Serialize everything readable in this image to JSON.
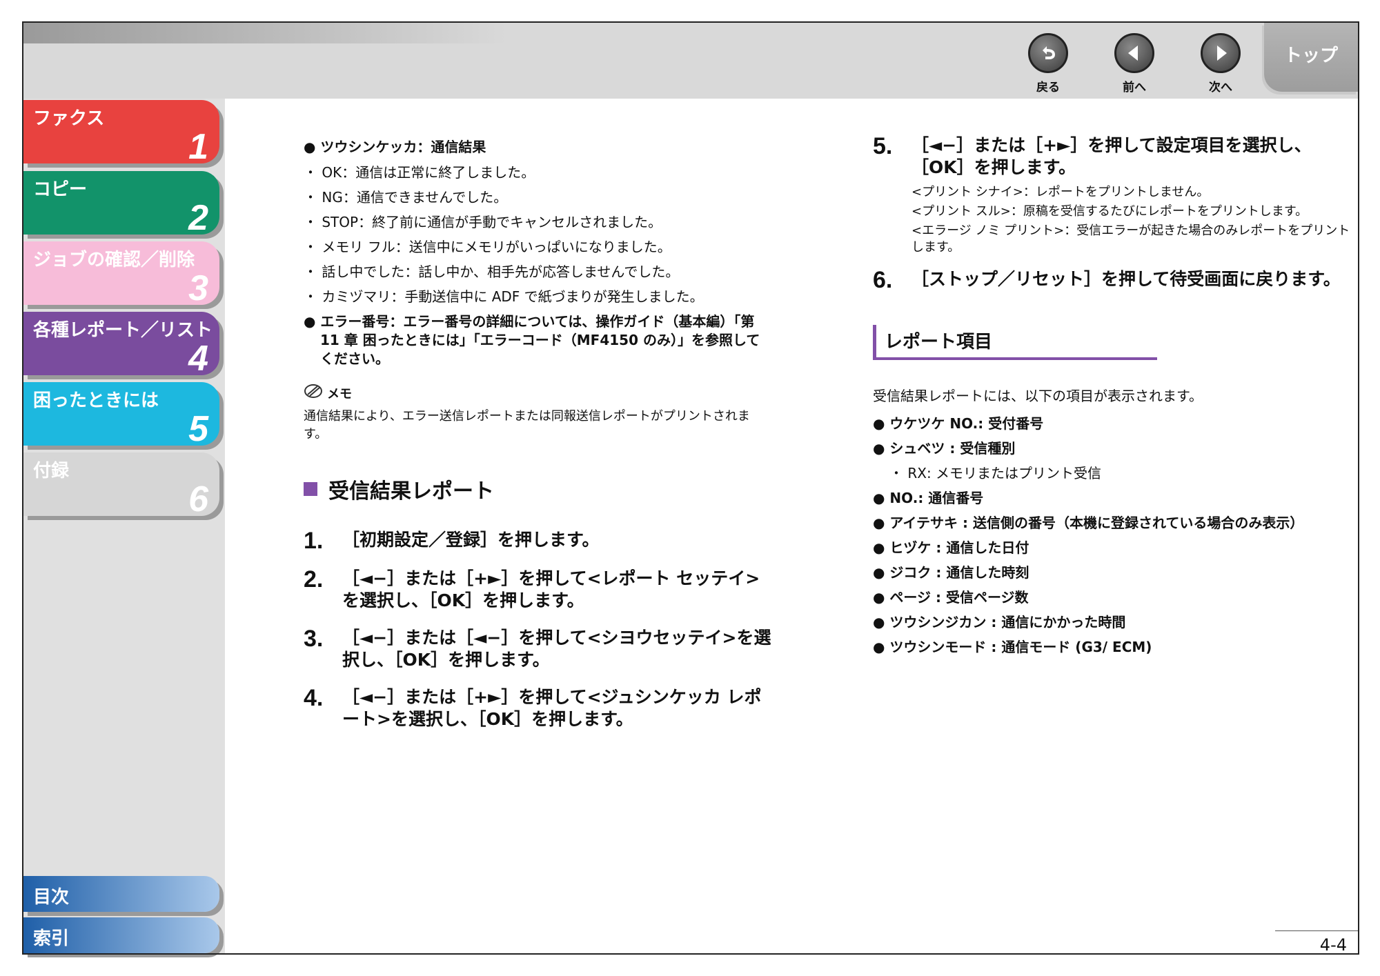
{
  "nav": {
    "back_label": "戻る",
    "prev_label": "前へ",
    "next_label": "次へ",
    "top_label": "トップ"
  },
  "chapters": [
    {
      "label": "ファクス",
      "number": "1",
      "color": "#e8423f"
    },
    {
      "label": "コピー",
      "number": "2",
      "color": "#12936a"
    },
    {
      "label": "ジョブの確認／削除",
      "number": "3",
      "color": "#f7bcd9"
    },
    {
      "label": "各種レポート／リスト",
      "number": "4",
      "color": "#7a4c9e"
    },
    {
      "label": "困ったときには",
      "number": "5",
      "color": "#1db8df"
    },
    {
      "label": "付録",
      "number": "6",
      "color": "#d6d6d6"
    }
  ],
  "bottom_nav": {
    "contents_label": "目次",
    "index_label": "索引"
  },
  "left": {
    "bullet1": "● ツウシンケッカ：通信結果",
    "items": [
      "・ OK：通信は正常に終了しました。",
      "・ NG：通信できませんでした。",
      "・ STOP：終了前に通信が手動でキャンセルされました。",
      "・ メモリ フル：送信中にメモリがいっぱいになりました。",
      "・ 話し中でした：話し中か、相手先が応答しませんでした。",
      "・ カミヅマリ：手動送信中に ADF で紙づまりが発生しました。"
    ],
    "bullet2": "● エラー番号：エラー番号の詳細については、操作ガイド（基本編）「第 11 章 困ったときには」「エラーコード（MF4150 のみ）」を参照してください。",
    "memo_title": "メモ",
    "memo_text": "通信結果により、エラー送信レポートまたは同報送信レポートがプリントされます。",
    "section_title": "受信結果レポート",
    "steps": [
      {
        "n": "1.",
        "text": "［初期設定／登録］を押します。"
      },
      {
        "n": "2.",
        "text": "［◄−］または［+►］を押して<レポート セッテイ>を選択し、［OK］を押します。"
      },
      {
        "n": "3.",
        "text": "［◄−］または［◄−］を押して<シヨウセッテイ>を選択し、［OK］を押します。"
      },
      {
        "n": "4.",
        "text": "［◄−］または［+►］を押して<ジュシンケッカ レポート>を選択し、［OK］を押します。"
      }
    ]
  },
  "right": {
    "step5": {
      "n": "5.",
      "text": "［◄−］または［+►］を押して設定項目を選択し、［OK］を押します。"
    },
    "step5_subs": [
      "<プリント シナイ>：レポートをプリントしません。",
      "<プリント スル>：原稿を受信するたびにレポートをプリントします。",
      "<エラージ ノミ プリント>：受信エラーが起きた場合のみレポートをプリントします。"
    ],
    "step6": {
      "n": "6.",
      "text": "［ストップ／リセット］を押して待受画面に戻ります。"
    },
    "subsection_title": "レポート項目",
    "intro": "受信結果レポートには、以下の項目が表示されます。",
    "report_items": [
      {
        "type": "bold",
        "text": "● ウケツケ NO.: 受付番号"
      },
      {
        "type": "bold",
        "text": "● シュベツ : 受信種別"
      },
      {
        "type": "dot",
        "text": "・ RX: メモリまたはプリント受信"
      },
      {
        "type": "bold",
        "text": "● NO.: 通信番号"
      },
      {
        "type": "bold",
        "text": "● アイテサキ : 送信側の番号（本機に登録されている場合のみ表示）"
      },
      {
        "type": "bold",
        "text": "● ヒヅケ : 通信した日付"
      },
      {
        "type": "bold",
        "text": "● ジコク : 通信した時刻"
      },
      {
        "type": "bold",
        "text": "● ページ : 受信ページ数"
      },
      {
        "type": "bold",
        "text": "● ツウシンジカン : 通信にかかった時間"
      },
      {
        "type": "bold",
        "text": "● ツウシンモード : 通信モード (G3/ ECM)"
      }
    ]
  },
  "page_number": "4-4"
}
